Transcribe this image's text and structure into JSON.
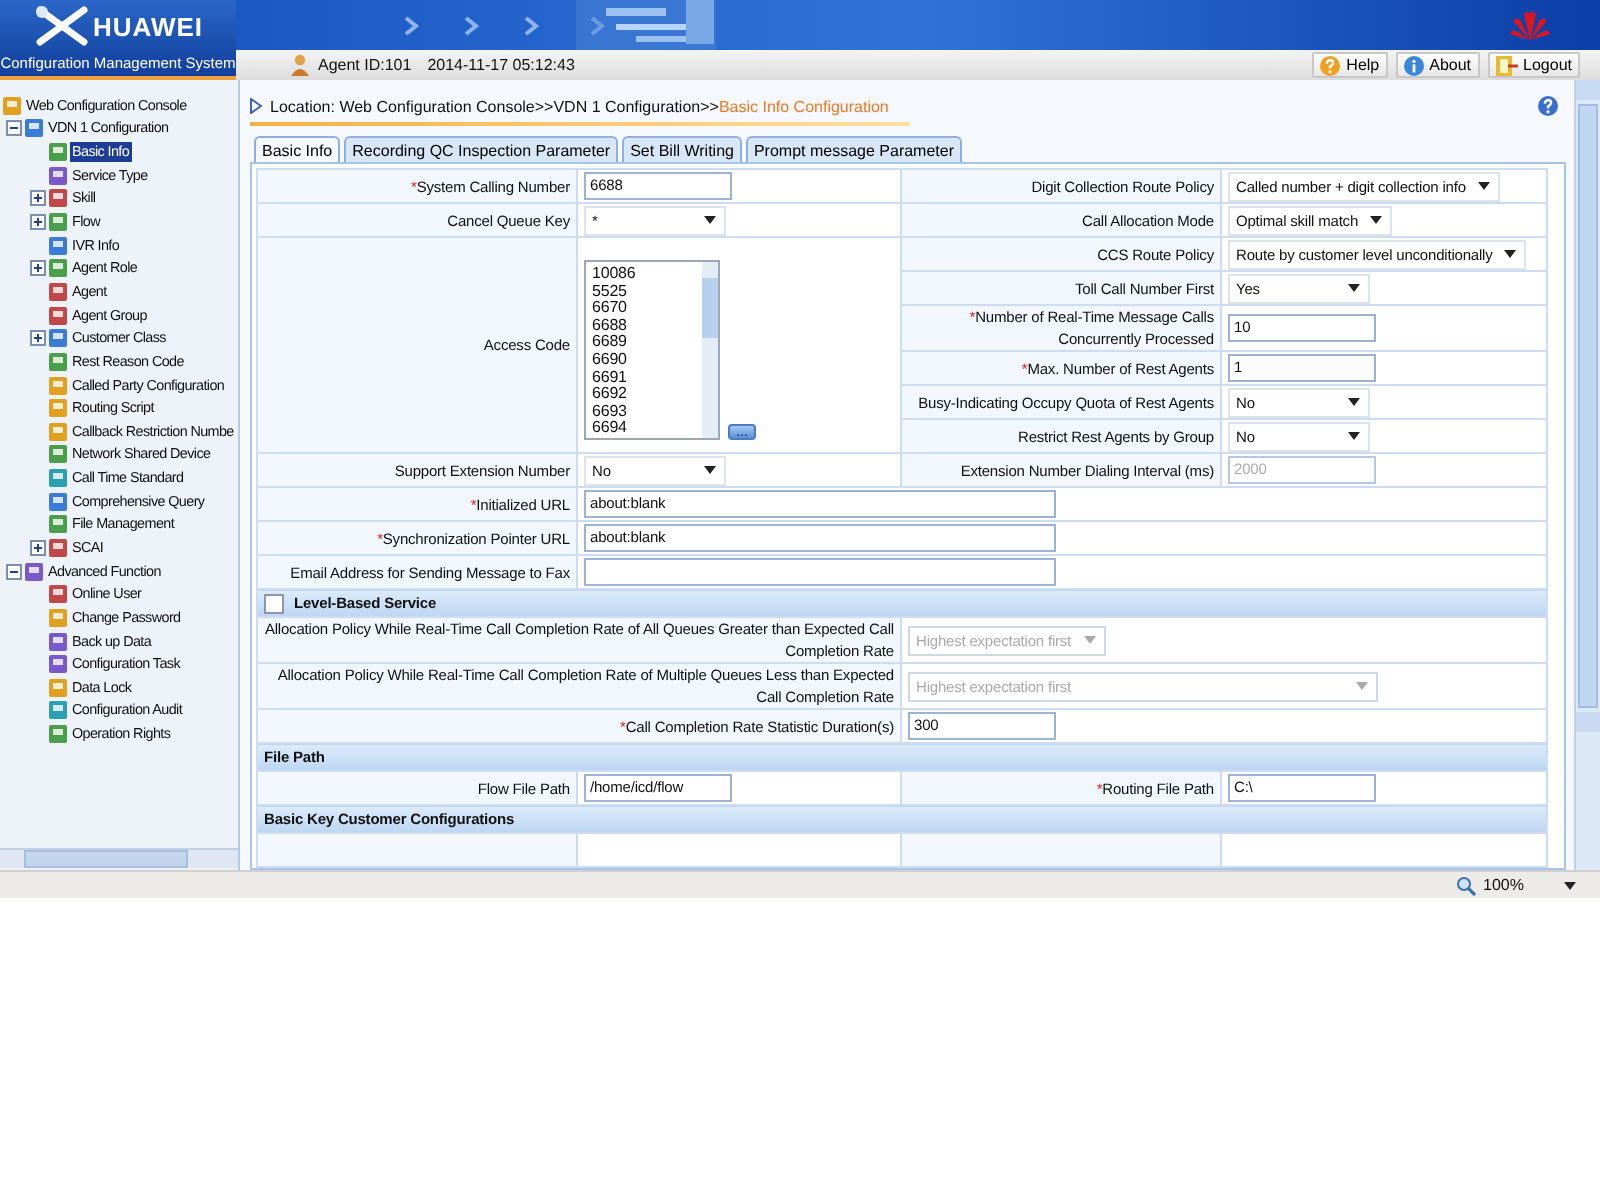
{
  "header": {
    "brand": "HUAWEI",
    "subtitle": "Configuration Management System",
    "agent_id": "Agent ID:101",
    "datetime": "2014-11-17 05:12:43",
    "buttons": [
      {
        "label": "Help",
        "kind": "help"
      },
      {
        "label": "About",
        "kind": "about"
      },
      {
        "label": "Logout",
        "kind": "logout"
      }
    ]
  },
  "tree": [
    {
      "label": "Web Configuration Console",
      "selected": false,
      "children": [
        {
          "label": "VDN 1 Configuration",
          "expanded": true,
          "selected": false,
          "children": [
            {
              "label": "Basic Info",
              "selected": true
            },
            {
              "label": "Service Type",
              "selected": false
            },
            {
              "label": "Skill",
              "expanded": false,
              "selected": false
            },
            {
              "label": "Flow",
              "expanded": false,
              "selected": false
            },
            {
              "label": "IVR Info",
              "selected": false
            },
            {
              "label": "Agent Role",
              "expanded": false,
              "selected": false
            },
            {
              "label": "Agent",
              "selected": false
            },
            {
              "label": "Agent Group",
              "selected": false
            },
            {
              "label": "Customer Class",
              "expanded": false,
              "selected": false
            },
            {
              "label": "Rest Reason Code",
              "selected": false
            },
            {
              "label": "Called Party Configuration",
              "selected": false
            },
            {
              "label": "Routing Script",
              "selected": false
            },
            {
              "label": "Callback Restriction Numbe",
              "selected": false
            },
            {
              "label": "Network Shared Device",
              "selected": false
            },
            {
              "label": "Call Time Standard",
              "selected": false
            },
            {
              "label": "Comprehensive Query",
              "selected": false
            },
            {
              "label": "File Management",
              "selected": false
            },
            {
              "label": "SCAI",
              "expanded": false,
              "selected": false
            }
          ]
        },
        {
          "label": "Advanced Function",
          "expanded": true,
          "selected": false,
          "children": [
            {
              "label": "Online User",
              "selected": false
            },
            {
              "label": "Change Password",
              "selected": false
            },
            {
              "label": "Back up Data",
              "selected": false
            },
            {
              "label": "Configuration Task",
              "selected": false
            },
            {
              "label": "Data Lock",
              "selected": false
            },
            {
              "label": "Configuration Audit",
              "selected": false
            },
            {
              "label": "Operation Rights",
              "selected": false
            }
          ]
        }
      ]
    }
  ],
  "location": {
    "path": "Location: Web Configuration Console>>VDN 1 Configuration>>",
    "current": "Basic Info Configuration"
  },
  "tabs": [
    {
      "label": "Basic Info",
      "selected": true
    },
    {
      "label": "Recording QC Inspection Parameter",
      "selected": false
    },
    {
      "label": "Set Bill Writing",
      "selected": false
    },
    {
      "label": "Prompt message Parameter",
      "selected": false
    }
  ],
  "form": {
    "groups": [
      {
        "left": {
          "label": "System Calling Number",
          "required_mark": "*",
          "kind": "text",
          "value": "6688"
        },
        "right": [
          {
            "label": "Digit Collection Route Policy",
            "kind": "select",
            "value": "Called number + digit collection info"
          }
        ]
      },
      {
        "left": {
          "label": "Cancel Queue Key",
          "kind": "select",
          "value": "*"
        },
        "right": [
          {
            "label": "Call Allocation Mode",
            "kind": "select",
            "value": "Optimal skill match"
          }
        ]
      },
      {
        "left": {
          "label": "Access Code",
          "kind": "list",
          "items": [
            "10086",
            "5525",
            "6670",
            "6688",
            "6689",
            "6690",
            "6691",
            "6692",
            "6693",
            "6694"
          ],
          "button": "..."
        },
        "right": [
          {
            "label": "CCS Route Policy",
            "kind": "select",
            "value": "Route by customer level unconditionally"
          },
          {
            "label": "Toll Call Number First",
            "kind": "select",
            "value": "Yes"
          },
          {
            "label": "Number of Real-Time Message Calls Concurrently Processed",
            "required_mark": "*",
            "kind": "text",
            "value": "10"
          },
          {
            "label": "Max. Number of Rest Agents",
            "required_mark": "*",
            "kind": "text",
            "value": "1"
          },
          {
            "label": "Busy-Indicating Occupy Quota of Rest Agents",
            "kind": "select",
            "value": "No"
          },
          {
            "label": "Restrict Rest Agents by Group",
            "kind": "select",
            "value": "No"
          }
        ]
      },
      {
        "left": {
          "label": "Support Extension Number",
          "kind": "select",
          "value": "No"
        },
        "right": [
          {
            "label": "Extension Number Dialing Interval (ms)",
            "kind": "text",
            "value": "2000",
            "disabled": true
          }
        ]
      }
    ],
    "wide_rows": [
      {
        "label": "Initialized URL",
        "required_mark": "*",
        "kind": "text",
        "value": "about:blank"
      },
      {
        "label": "Synchronization Pointer URL",
        "required_mark": "*",
        "kind": "text",
        "value": "about:blank"
      },
      {
        "label": "Email Address for Sending Message to Fax",
        "kind": "text"
      }
    ],
    "sections": [
      {
        "title": "Level-Based Service",
        "checked": false,
        "rows": [
          {
            "fields": [
              {
                "label": "Allocation Policy While Real-Time Call Completion Rate of All Queues Greater than Expected Call Completion Rate",
                "kind": "select",
                "value": "Highest expectation first",
                "disabled": true
              }
            ]
          },
          {
            "fields": [
              {
                "label": "Allocation Policy While Real-Time Call Completion Rate of Multiple Queues Less than Expected Call Completion Rate",
                "kind": "select",
                "value": "Highest expectation first",
                "disabled": true,
                "wide": true
              }
            ]
          },
          {
            "fields": [
              {
                "label": "Call Completion Rate Statistic Duration(s)",
                "required_mark": "*",
                "kind": "text",
                "value": "300"
              }
            ]
          }
        ]
      },
      {
        "title": "File Path",
        "rows": [
          {
            "fields": [
              {
                "label": "Flow File Path",
                "kind": "text",
                "value": "/home/icd/flow"
              },
              {
                "label": "Routing File Path",
                "required_mark": "*",
                "kind": "text",
                "value": "C:\\"
              }
            ]
          }
        ]
      },
      {
        "title": "Basic Key Customer Configurations"
      }
    ]
  },
  "status_bar": {
    "zoom": "100%"
  }
}
